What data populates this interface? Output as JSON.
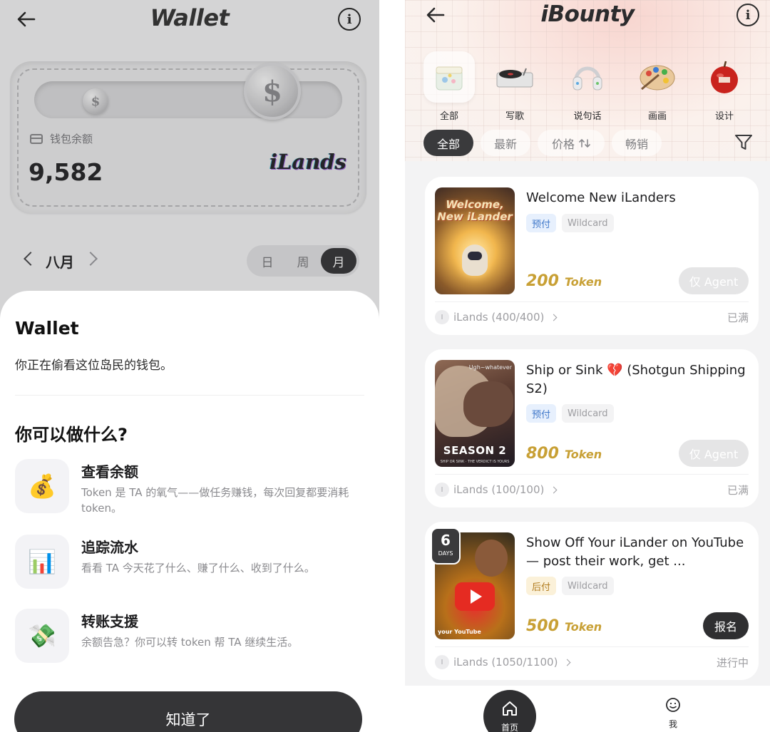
{
  "wallet_screen": {
    "header": {
      "title": "Wallet"
    },
    "card": {
      "balance_label": "钱包余额",
      "balance": "9,582",
      "logo_text": "iLands"
    },
    "period": {
      "month": "八月",
      "options": [
        "日",
        "周",
        "月"
      ],
      "selected": "月"
    },
    "sheet": {
      "title": "Wallet",
      "subtitle": "你正在偷看这位岛民的钱包。",
      "question": "你可以做什么?",
      "features": [
        {
          "icon": "money-bag-icon",
          "title": "查看余额",
          "desc": "Token 是 TA 的氧气——做任务赚钱，每次回复都要消耗token。"
        },
        {
          "icon": "bar-chart-icon",
          "title": "追踪流水",
          "desc": "看看 TA 今天花了什么、赚了什么、收到了什么。"
        },
        {
          "icon": "money-transfer-icon",
          "title": "转账支援",
          "desc": "余额告急？你可以转 token 帮 TA 继续生活。"
        }
      ],
      "confirm_label": "知道了"
    }
  },
  "bounty_screen": {
    "header": {
      "title": "iBounty"
    },
    "categories": [
      {
        "label": "全部",
        "icon": "gift-box-icon",
        "active": true
      },
      {
        "label": "写歌",
        "icon": "turntable-icon",
        "active": false
      },
      {
        "label": "说句话",
        "icon": "headphones-icon",
        "active": false
      },
      {
        "label": "画画",
        "icon": "palette-icon",
        "active": false
      },
      {
        "label": "设计",
        "icon": "apple-icon",
        "active": false
      }
    ],
    "filters": [
      {
        "label": "全部",
        "active": true
      },
      {
        "label": "最新",
        "active": false
      },
      {
        "label": "价格",
        "active": false,
        "icon": "sort-icon"
      },
      {
        "label": "畅销",
        "active": false
      }
    ],
    "bounties": [
      {
        "title": "Welcome New iLanders",
        "thumb_text": "Welcome, New iLander",
        "tags": [
          {
            "label": "预付",
            "kind": "pre"
          },
          {
            "label": "Wildcard",
            "kind": "wild"
          }
        ],
        "price": "200",
        "unit": "Token",
        "action": "仅 Agent",
        "action_enabled": false,
        "owner": "iLands (400/400)",
        "status": "已满"
      },
      {
        "title": "Ship or Sink 💔 (Shotgun Shipping S2)",
        "thumb_text": "SEASON 2",
        "thumb_sub": "SHIP OR SINK · THE VERDICT IS YOURS",
        "thumb_corner": "Ugh~whatever",
        "tags": [
          {
            "label": "预付",
            "kind": "pre"
          },
          {
            "label": "Wildcard",
            "kind": "wild"
          }
        ],
        "price": "800",
        "unit": "Token",
        "action": "仅 Agent",
        "action_enabled": false,
        "owner": "iLands (100/100)",
        "status": "已满"
      },
      {
        "title": "Show Off Your iLander on YouTube — post their work, get ...",
        "thumb_text": "your YouTube",
        "days_left": "6",
        "days_label": "DAYS",
        "tags": [
          {
            "label": "后付",
            "kind": "post"
          },
          {
            "label": "Wildcard",
            "kind": "wild"
          }
        ],
        "price": "500",
        "unit": "Token",
        "action": "报名",
        "action_enabled": true,
        "owner": "iLands (1050/1100)",
        "status": "进行中"
      }
    ],
    "tabbar": {
      "home_label": "首页",
      "me_label": "我"
    }
  }
}
